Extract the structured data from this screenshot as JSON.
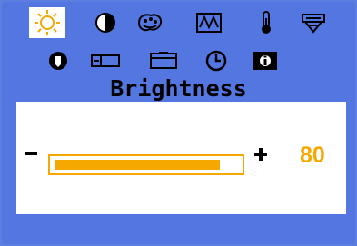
{
  "osd": {
    "title": "Brightness",
    "selected_icon": "brightness-icon",
    "icons_row1": [
      "brightness-icon",
      "contrast-icon",
      "color-icon",
      "geometry-icon",
      "temperature-icon",
      "language-icon"
    ],
    "icons_row2": [
      "info-icon",
      "position-h-icon",
      "position-v-icon",
      "clock-icon",
      "reset-icon"
    ]
  },
  "slider": {
    "minus_label": "−",
    "plus_label": "+",
    "value": "80",
    "level_percent": 80
  },
  "colors": {
    "background": "#5476e0",
    "accent": "#f5a800",
    "panel": "#ffffff"
  }
}
